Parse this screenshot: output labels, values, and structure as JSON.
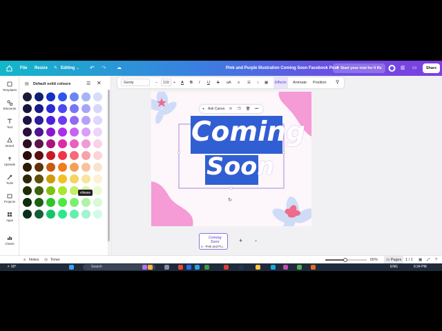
{
  "app": {
    "home_icon": "home-icon",
    "file_menu": "File",
    "resize_menu": "Resize",
    "editing_mode": "Editing",
    "doc_title": "Pink and Purple Illustration Coming Soon Facebook Post",
    "trial_button": "Start your trial for 0 Rs",
    "share_button": "Share"
  },
  "rail": [
    {
      "label": "Templates",
      "icon": "templates-icon"
    },
    {
      "label": "Elements",
      "icon": "elements-icon"
    },
    {
      "label": "Text",
      "icon": "text-icon"
    },
    {
      "label": "Brand",
      "icon": "brand-icon"
    },
    {
      "label": "Uploads",
      "icon": "uploads-icon"
    },
    {
      "label": "Tools",
      "icon": "tools-icon"
    },
    {
      "label": "Projects",
      "icon": "projects-icon"
    },
    {
      "label": "Apps",
      "icon": "apps-icon"
    },
    {
      "label": "Charts",
      "icon": "charts-icon"
    }
  ],
  "panel": {
    "title": "Default solid colours",
    "tooltip": "#ff9999",
    "columns": [
      [
        "#1b1b3a",
        "#15153f",
        "#1f1247",
        "#2a0f3d",
        "#2c0d21",
        "#2a0a0a",
        "#2e1a07",
        "#2e2707",
        "#1f2d07",
        "#0e2d0c",
        "#0b2d1a"
      ],
      [
        "#102070",
        "#1b1a8a",
        "#2c1d9a",
        "#4d1590",
        "#5c1548",
        "#5c1010",
        "#5f3308",
        "#5f4f0a",
        "#3f600d",
        "#1e5f16",
        "#135f36"
      ],
      [
        "#1530c5",
        "#2a2ad6",
        "#4b21e0",
        "#8a16d0",
        "#a8137c",
        "#c81a26",
        "#c95b0f",
        "#cf9c0e",
        "#7fc312",
        "#2ec52a",
        "#14c56a"
      ],
      [
        "#2d55ef",
        "#4b49ef",
        "#6d3bf2",
        "#ad2cf0",
        "#de2aa5",
        "#f23447",
        "#f07c1b",
        "#f2c123",
        "#a8e82a",
        "#4ce844",
        "#2be88c"
      ],
      [
        "#6a86f3",
        "#7876f4",
        "#9268f5",
        "#c564f4",
        "#e861bf",
        "#f46b78",
        "#f4a05a",
        "#f5d45f",
        "#c2ef67",
        "#7cee72",
        "#64efaf"
      ],
      [
        "#a3b4f7",
        "#a8a5f7",
        "#b8a0f8",
        "#d99ef7",
        "#f09ad6",
        "#f7a2ab",
        "#f8c39a",
        "#f8e59c",
        "#daf5a3",
        "#aef3a6",
        "#a1f5cf"
      ],
      [
        "#d6ddfb",
        "#d8d6fb",
        "#e0d5fc",
        "#eed4fb",
        "#f8d2ea",
        "#fbd4d8",
        "#fbe2cf",
        "#fcf2d0",
        "#ecfad2",
        "#d7f9d3",
        "#d2fae8"
      ]
    ]
  },
  "toolbar2": {
    "font_name": "Genty",
    "font_size": "110",
    "effects": "Effects",
    "animate": "Animate",
    "position": "Position"
  },
  "canvas": {
    "ask_canva": "Ask Canva",
    "line1": "Coming",
    "line2": "Soon"
  },
  "pages": {
    "thumb_line1": "Coming",
    "thumb_line2": "Soon",
    "thumb_caption": "1 - Pink and Pu..."
  },
  "bottombar": {
    "notes": "Notes",
    "timer": "Timer",
    "zoom": "65%",
    "pages_label": "Pages",
    "page_count": "1 / 1"
  },
  "taskbar": {
    "weather": "90°",
    "search": "Search",
    "time": "6:34 PM",
    "date": "",
    "lang": "ENG"
  },
  "colors": {
    "canvas_bg": "#fdf6fa",
    "pink_blob": "#f59bd6",
    "light_blue_flower": "#cfdcf7",
    "selection_blue": "#2f5fd2"
  }
}
